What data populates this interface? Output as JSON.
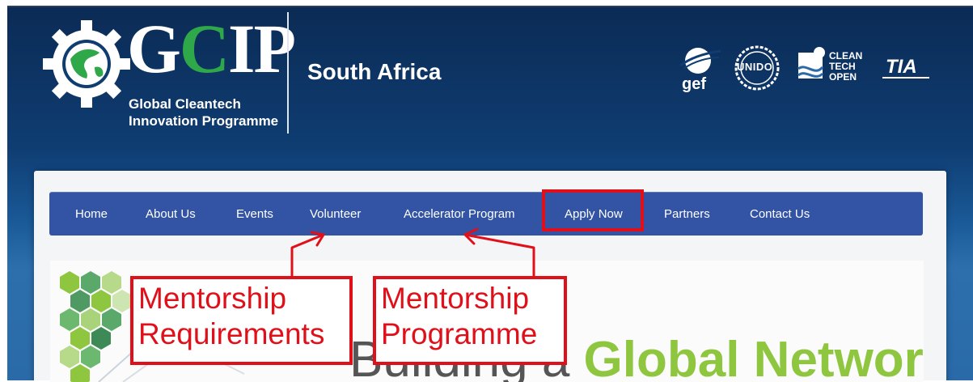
{
  "header": {
    "logo_text": "GCIP",
    "logo_sub_line1": "Global Cleantech",
    "logo_sub_line2": "Innovation Programme",
    "region": "South Africa"
  },
  "partners": [
    {
      "name": "gef",
      "icon": "gef-logo"
    },
    {
      "name": "UNIDO",
      "icon": "unido-logo"
    },
    {
      "name": "CLEAN TECH OPEN",
      "icon": "cleantech-open-logo"
    },
    {
      "name": "TIA",
      "icon": "tia-logo"
    }
  ],
  "nav": {
    "items": [
      {
        "label": "Home"
      },
      {
        "label": "About Us"
      },
      {
        "label": "Events"
      },
      {
        "label": "Volunteer"
      },
      {
        "label": "Accelerator Program"
      },
      {
        "label": "Apply Now"
      },
      {
        "label": "Partners"
      },
      {
        "label": "Contact Us"
      }
    ],
    "highlighted": "Apply Now"
  },
  "hero": {
    "title_plain": "Building a",
    "title_accent": "Global Network"
  },
  "annotations": [
    {
      "line1": "Mentorship",
      "line2": "Requirements",
      "points_to": "Volunteer"
    },
    {
      "line1": "Mentorship",
      "line2": "Programme",
      "points_to": "Accelerator Program"
    }
  ],
  "colors": {
    "header_bg": "#0f3d72",
    "nav_bg": "#3354a4",
    "annotation_red": "#e0101a",
    "accent_green": "#8fc63f",
    "logo_green": "#2fa84a"
  }
}
